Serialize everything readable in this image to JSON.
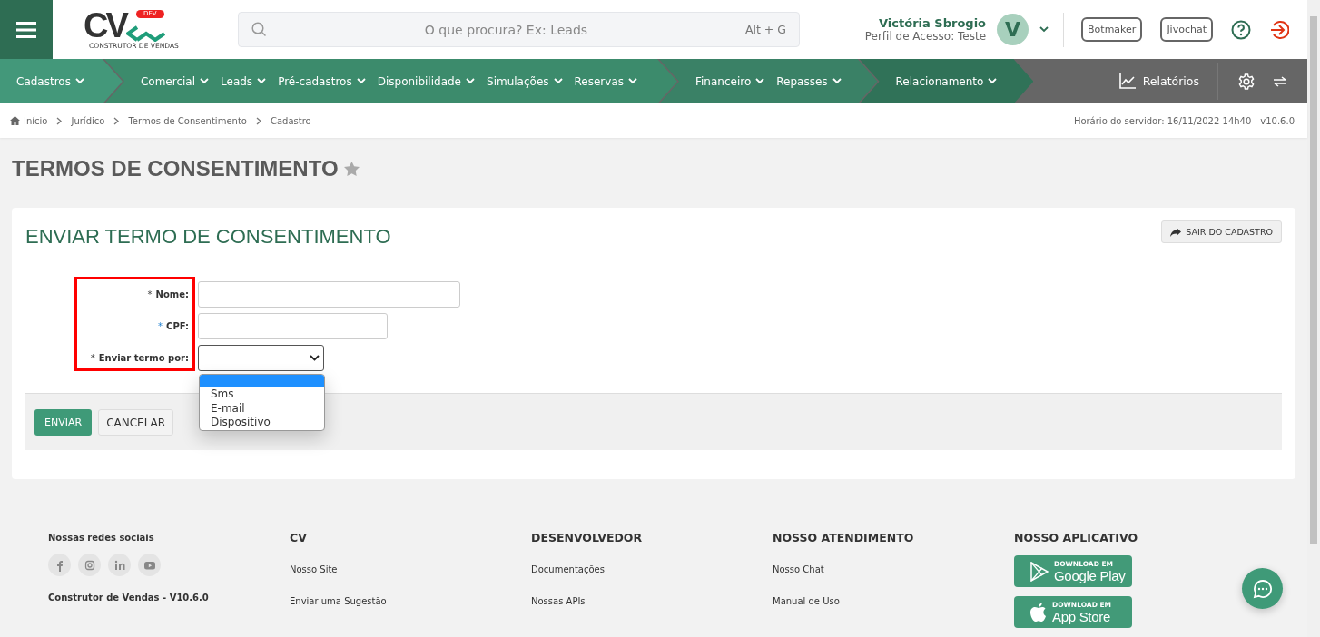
{
  "header": {
    "logo": {
      "letters": "CV",
      "badge": "DEV",
      "subtitle": "CONSTRUTOR DE VENDAS"
    },
    "search": {
      "placeholder": "O que procura? Ex: Leads",
      "shortcut": "Alt + G"
    },
    "user": {
      "name": "Victória Sbrogio",
      "profile": "Perfil de Acesso: Teste",
      "avatar_letter": "V"
    },
    "buttons": [
      "Botmaker",
      "Jivochat"
    ]
  },
  "nav": {
    "groups": [
      {
        "color": "#43987a",
        "items": [
          "Cadastros"
        ]
      },
      {
        "color": "#3c8b6c",
        "items": [
          "Comercial",
          "Leads",
          "Pré-cadastros",
          "Disponibilidade",
          "Simulações",
          "Reservas"
        ]
      },
      {
        "color": "#3a8166",
        "items": [
          "Financeiro",
          "Repasses"
        ]
      },
      {
        "color": "#307258",
        "items": [
          "Relacionamento"
        ]
      }
    ],
    "reports": "Relatórios"
  },
  "breadcrumb": [
    "Início",
    "Jurídico",
    "Termos de Consentimento",
    "Cadastro"
  ],
  "server_time": "Horário do servidor: 16/11/2022 14h40 - v10.6.0",
  "page_title": "TERMOS DE CONSENTIMENTO",
  "card": {
    "title": "ENVIAR TERMO DE CONSENTIMENTO",
    "exit_button": "SAIR DO CADASTRO",
    "labels_highlighted": true,
    "fields": [
      {
        "kind": "text",
        "label": "Nome:",
        "required_mark": "*"
      },
      {
        "kind": "text",
        "label": "CPF:",
        "required_mark": "*"
      },
      {
        "kind": "select",
        "label": "Enviar termo por:",
        "required_mark": "*",
        "expanded": true,
        "options": [
          "Sms",
          "E-mail",
          "Dispositivo"
        ]
      }
    ],
    "buttons": [
      "ENVIAR",
      "CANCELAR"
    ]
  },
  "footer": {
    "social_title": "Nossas redes sociais",
    "version": "Construtor de Vendas - V10.6.0",
    "columns": [
      {
        "title": "CV",
        "links": [
          "Nosso Site",
          "Enviar uma Sugestão"
        ]
      },
      {
        "title": "DESENVOLVEDOR",
        "links": [
          "Documentações",
          "Nossas APIs"
        ]
      },
      {
        "title": "NOSSO ATENDIMENTO",
        "links": [
          "Nosso Chat",
          "Manual de Uso"
        ]
      }
    ],
    "app": {
      "title": "NOSSO APLICATIVO",
      "stores": [
        {
          "kind": "google",
          "caption": "DOWNLOAD EM",
          "name": "Google Play"
        },
        {
          "kind": "apple",
          "caption": "DOWNLOAD EM",
          "name": "App Store"
        }
      ]
    }
  }
}
